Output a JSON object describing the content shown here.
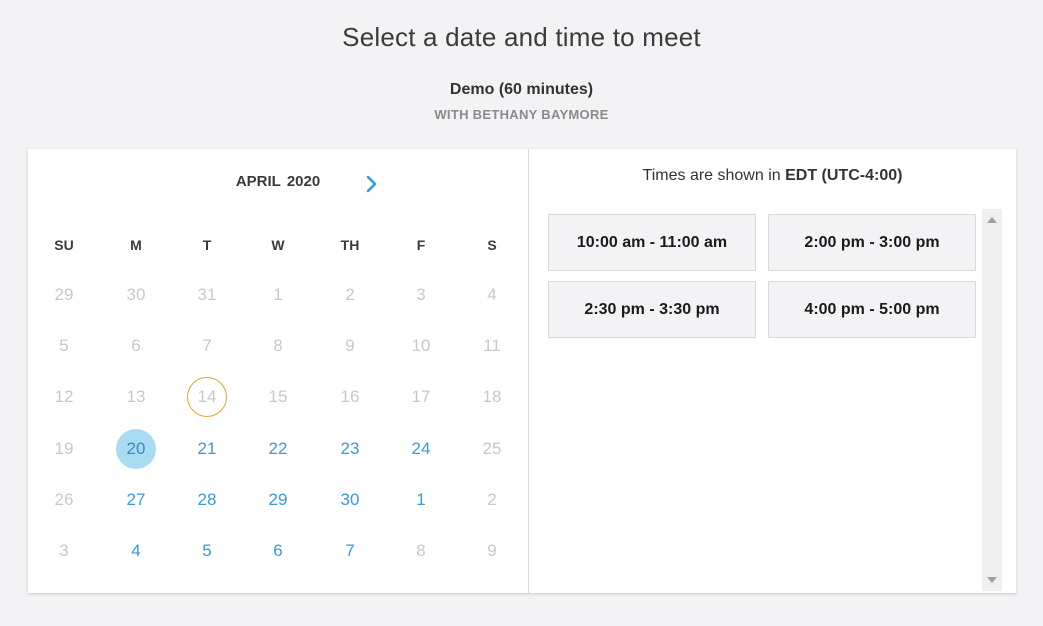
{
  "header": {
    "title": "Select a date and time to meet",
    "event_name": "Demo (60 minutes)",
    "host": "WITH BETHANY BAYMORE"
  },
  "calendar": {
    "month": "APRIL",
    "year": "2020",
    "next_icon": "chevron-right-icon",
    "weekdays": [
      "SU",
      "M",
      "T",
      "W",
      "TH",
      "F",
      "S"
    ],
    "weeks": [
      [
        {
          "d": "29",
          "s": "disabled"
        },
        {
          "d": "30",
          "s": "disabled"
        },
        {
          "d": "31",
          "s": "disabled"
        },
        {
          "d": "1",
          "s": "disabled"
        },
        {
          "d": "2",
          "s": "disabled"
        },
        {
          "d": "3",
          "s": "disabled"
        },
        {
          "d": "4",
          "s": "disabled"
        }
      ],
      [
        {
          "d": "5",
          "s": "disabled"
        },
        {
          "d": "6",
          "s": "disabled"
        },
        {
          "d": "7",
          "s": "disabled"
        },
        {
          "d": "8",
          "s": "disabled"
        },
        {
          "d": "9",
          "s": "disabled"
        },
        {
          "d": "10",
          "s": "disabled"
        },
        {
          "d": "11",
          "s": "disabled"
        }
      ],
      [
        {
          "d": "12",
          "s": "disabled"
        },
        {
          "d": "13",
          "s": "disabled"
        },
        {
          "d": "14",
          "s": "today"
        },
        {
          "d": "15",
          "s": "disabled"
        },
        {
          "d": "16",
          "s": "disabled"
        },
        {
          "d": "17",
          "s": "disabled"
        },
        {
          "d": "18",
          "s": "disabled"
        }
      ],
      [
        {
          "d": "19",
          "s": "disabled"
        },
        {
          "d": "20",
          "s": "selected"
        },
        {
          "d": "21",
          "s": "available"
        },
        {
          "d": "22",
          "s": "available"
        },
        {
          "d": "23",
          "s": "available"
        },
        {
          "d": "24",
          "s": "available"
        },
        {
          "d": "25",
          "s": "disabled"
        }
      ],
      [
        {
          "d": "26",
          "s": "disabled"
        },
        {
          "d": "27",
          "s": "available"
        },
        {
          "d": "28",
          "s": "available"
        },
        {
          "d": "29",
          "s": "available"
        },
        {
          "d": "30",
          "s": "available"
        },
        {
          "d": "1",
          "s": "available"
        },
        {
          "d": "2",
          "s": "disabled"
        }
      ],
      [
        {
          "d": "3",
          "s": "disabled"
        },
        {
          "d": "4",
          "s": "available"
        },
        {
          "d": "5",
          "s": "available"
        },
        {
          "d": "6",
          "s": "available"
        },
        {
          "d": "7",
          "s": "available"
        },
        {
          "d": "8",
          "s": "disabled"
        },
        {
          "d": "9",
          "s": "disabled"
        }
      ]
    ]
  },
  "times": {
    "tz_prefix": "Times are shown in ",
    "tz_value": "EDT (UTC-4:00)",
    "slots": [
      "10:00 am - 11:00 am",
      "2:00 pm - 3:00 pm",
      "2:30 pm - 3:30 pm",
      "4:00 pm - 5:00 pm"
    ]
  },
  "colors": {
    "accent": "#3a9ad9",
    "selected_bg": "#a9dcf2",
    "today_ring": "#e0a42b",
    "disabled": "#c8c8c8"
  }
}
